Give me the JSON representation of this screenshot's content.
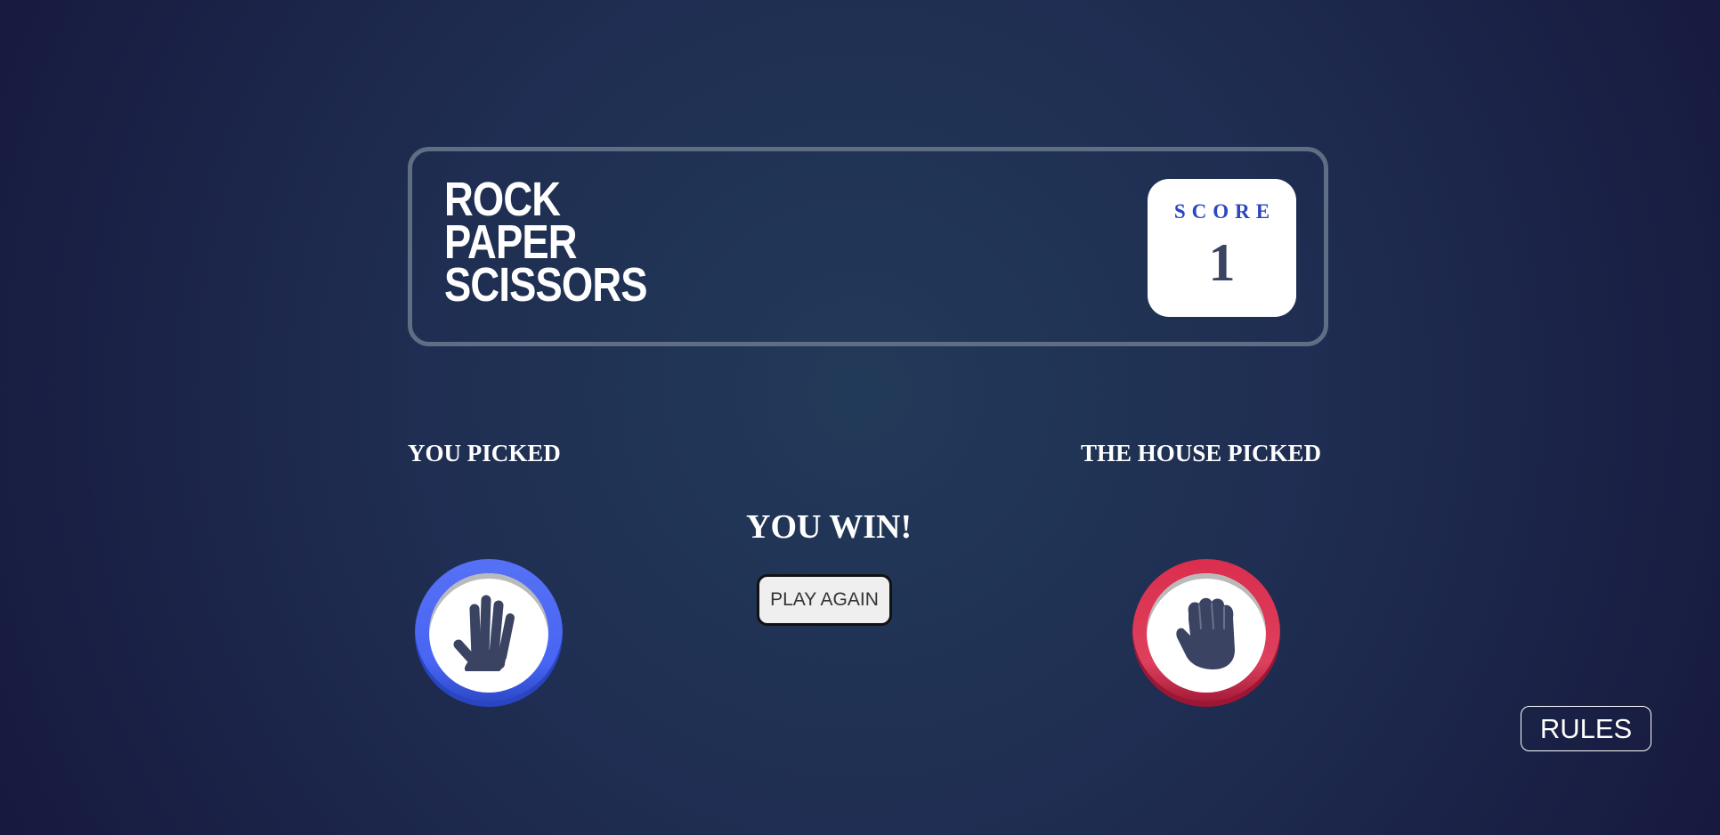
{
  "header": {
    "title_lines": [
      "ROCK",
      "PAPER",
      "SCISSORS"
    ],
    "score_label": "SCORE",
    "score_value": "1"
  },
  "game": {
    "you_label": "YOU PICKED",
    "house_label": "THE HOUSE PICKED",
    "result_text": "YOU WIN!",
    "play_again_label": "PLAY AGAIN",
    "player_choice": "paper",
    "house_choice": "rock"
  },
  "footer": {
    "rules_label": "RULES"
  },
  "colors": {
    "paper": "#4865f4",
    "rock": "#dc2e4e",
    "score_label": "#2a46c0",
    "score_value": "#3b4363",
    "header_border": "#606e85"
  },
  "icons": {
    "player": "paper-hand-icon",
    "house": "rock-fist-icon"
  }
}
